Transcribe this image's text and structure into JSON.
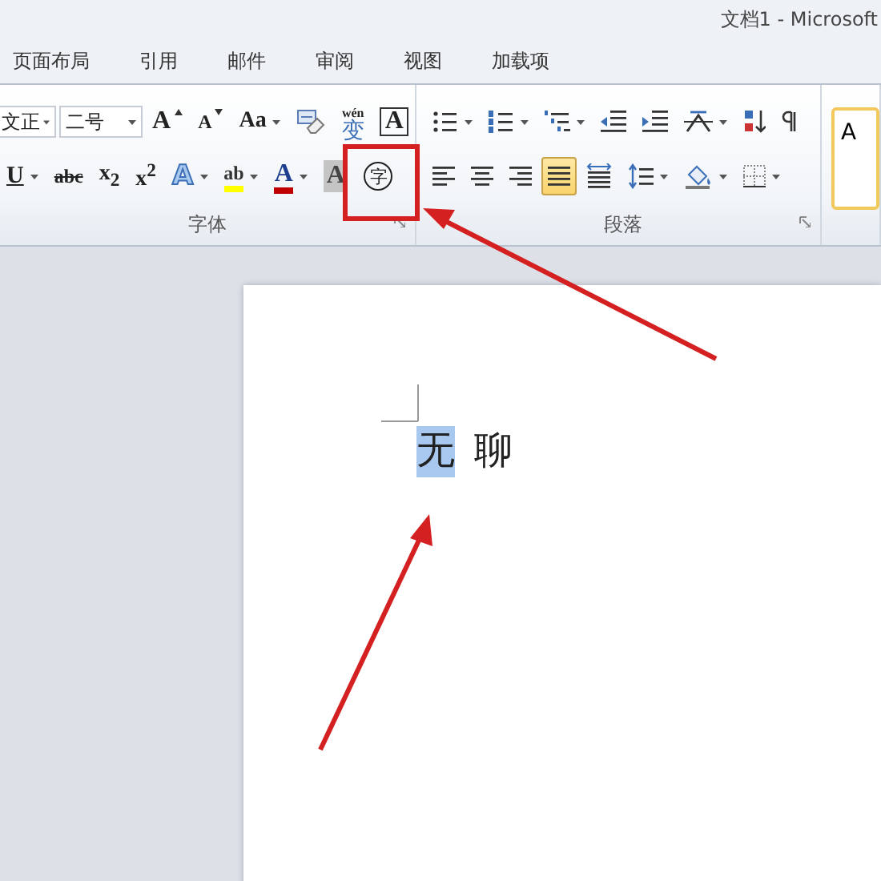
{
  "window": {
    "title": "文档1 - Microsoft"
  },
  "tabs": [
    {
      "label": "页面布局",
      "selected": false
    },
    {
      "label": "引用",
      "selected": false
    },
    {
      "label": "邮件",
      "selected": false
    },
    {
      "label": "审阅",
      "selected": false
    },
    {
      "label": "视图",
      "selected": false
    },
    {
      "label": "加载项",
      "selected": false
    }
  ],
  "font_group": {
    "label": "字体",
    "font_name": "文正",
    "font_size": "二号",
    "row_1": [
      {
        "kind": "grow",
        "label": "A"
      },
      {
        "kind": "shrink",
        "label": "A"
      },
      {
        "kind": "case",
        "label": "Aa",
        "has_menu": true
      },
      {
        "kind": "clear"
      },
      {
        "kind": "phonetic",
        "label": "变",
        "ruby": "wén"
      },
      {
        "kind": "border_char",
        "label": "A"
      }
    ],
    "row_2": [
      {
        "kind": "underline",
        "label": "U",
        "has_menu": true
      },
      {
        "kind": "strike",
        "label": "abc"
      },
      {
        "kind": "sub",
        "label": "x$_{2}$"
      },
      {
        "kind": "sup",
        "label": "x$^{2}$"
      },
      {
        "kind": "effects",
        "label": "A",
        "has_menu": true
      },
      {
        "kind": "highlight",
        "label": "ab",
        "has_menu": true
      },
      {
        "kind": "color",
        "label": "A",
        "has_menu": true
      },
      {
        "kind": "shading_char",
        "label": "A"
      },
      {
        "kind": "enclosed",
        "label": "字"
      }
    ]
  },
  "paragraph_group": {
    "label": "段落",
    "row_1": [
      {
        "kind": "bullets",
        "has_menu": true
      },
      {
        "kind": "numbering",
        "has_menu": true
      },
      {
        "kind": "multilevel",
        "has_menu": true
      },
      {
        "kind": "outdent"
      },
      {
        "kind": "indent"
      },
      {
        "kind": "asian",
        "has_menu": true
      },
      {
        "kind": "sort"
      },
      {
        "kind": "marks"
      }
    ],
    "row_2": [
      {
        "kind": "align_left",
        "selected": false
      },
      {
        "kind": "align_center",
        "selected": false
      },
      {
        "kind": "align_right",
        "selected": false
      },
      {
        "kind": "justify",
        "selected": true
      },
      {
        "kind": "distributed",
        "selected": false
      },
      {
        "kind": "spacing",
        "has_menu": true
      },
      {
        "kind": "shade",
        "has_menu": true
      },
      {
        "kind": "borders",
        "has_menu": true
      }
    ]
  },
  "styles_group": {
    "preview": "A"
  },
  "document": {
    "words": [
      {
        "text": "无",
        "selected": true
      },
      {
        "text": "聊",
        "selected": false
      }
    ]
  }
}
